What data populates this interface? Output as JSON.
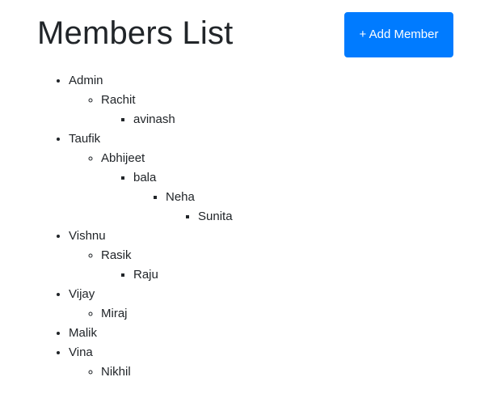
{
  "header": {
    "title": "Members List",
    "add_button_label": "+ Add Member"
  },
  "members": [
    {
      "name": "Admin",
      "children": [
        {
          "name": "Rachit",
          "children": [
            {
              "name": "avinash",
              "children": []
            }
          ]
        }
      ]
    },
    {
      "name": "Taufik",
      "children": [
        {
          "name": "Abhijeet",
          "children": [
            {
              "name": "bala",
              "children": [
                {
                  "name": "Neha",
                  "children": [
                    {
                      "name": "Sunita",
                      "children": []
                    }
                  ]
                }
              ]
            }
          ]
        }
      ]
    },
    {
      "name": "Vishnu",
      "children": [
        {
          "name": "Rasik",
          "children": [
            {
              "name": "Raju",
              "children": []
            }
          ]
        }
      ]
    },
    {
      "name": "Vijay",
      "children": [
        {
          "name": "Miraj",
          "children": []
        }
      ]
    },
    {
      "name": "Malik",
      "children": []
    },
    {
      "name": "Vina",
      "children": [
        {
          "name": "Nikhil",
          "children": []
        }
      ]
    }
  ],
  "colors": {
    "accent": "#007bff",
    "text": "#212529"
  }
}
